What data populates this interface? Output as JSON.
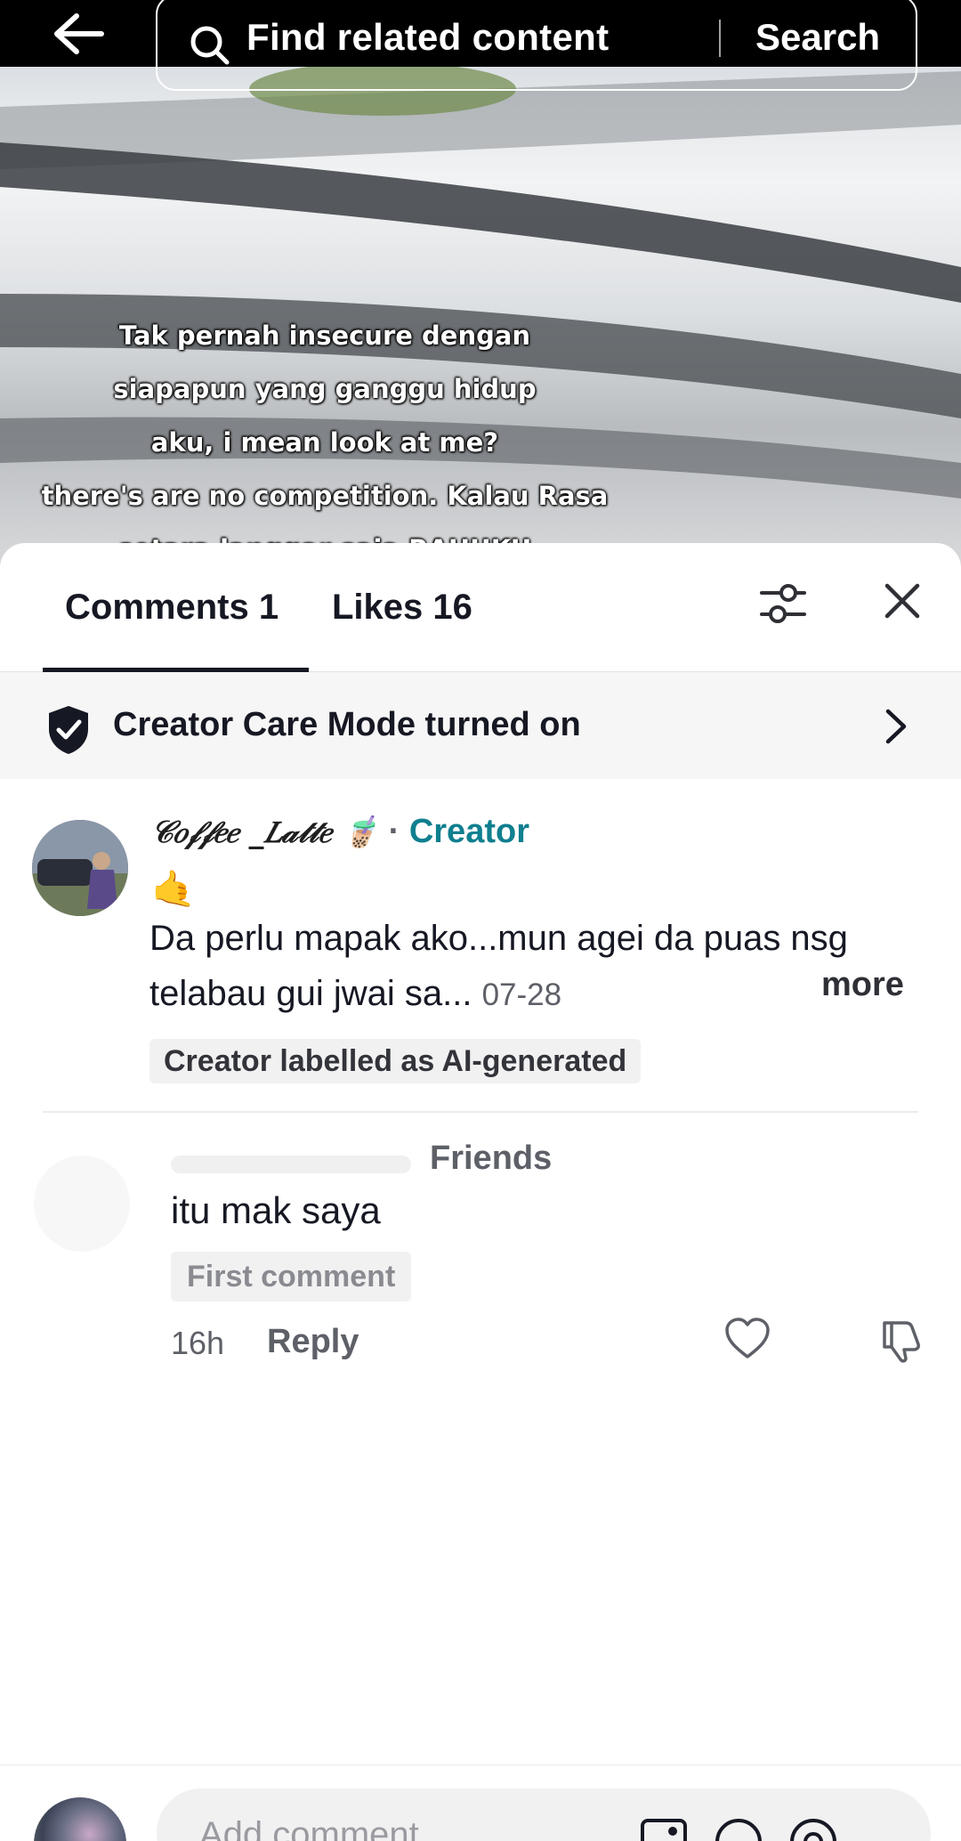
{
  "video": {
    "caption_lines": [
      "Tak pernah insecure dengan",
      "siapapun yang ganggu hidup",
      "aku, i mean look at me?",
      "there's are no competition. Kalau Rasa",
      "setara langgar saja RAHUKU"
    ]
  },
  "search": {
    "placeholder": "Find related content",
    "button_label": "Search"
  },
  "tabs": {
    "comments_label": "Comments 1",
    "likes_label": "Likes 16"
  },
  "banner": {
    "text": "Creator Care Mode turned on"
  },
  "comments": [
    {
      "username": "𝒞𝑜𝒻𝒻𝑒𝑒 _𝐿𝒶𝓉𝓉𝑒 🧋",
      "separator": "·",
      "badge": "Creator",
      "emoji_line": "🤙",
      "body": "Da perlu mapak ako...mun agei da puas nsg telabau gui jwai sa...",
      "date": "07-28",
      "more_label": "more",
      "tag": "Creator labelled as AI-generated"
    },
    {
      "relation": "Friends",
      "text": "itu mak saya",
      "tag": "First comment",
      "time": "16h",
      "reply_label": "Reply"
    }
  ],
  "composer": {
    "placeholder": "Add comment..."
  },
  "colors": {
    "creator_badge": "#0f7f8f",
    "text_primary": "#161823",
    "text_secondary": "#5e6068",
    "banner_bg": "#f6f6f6"
  }
}
